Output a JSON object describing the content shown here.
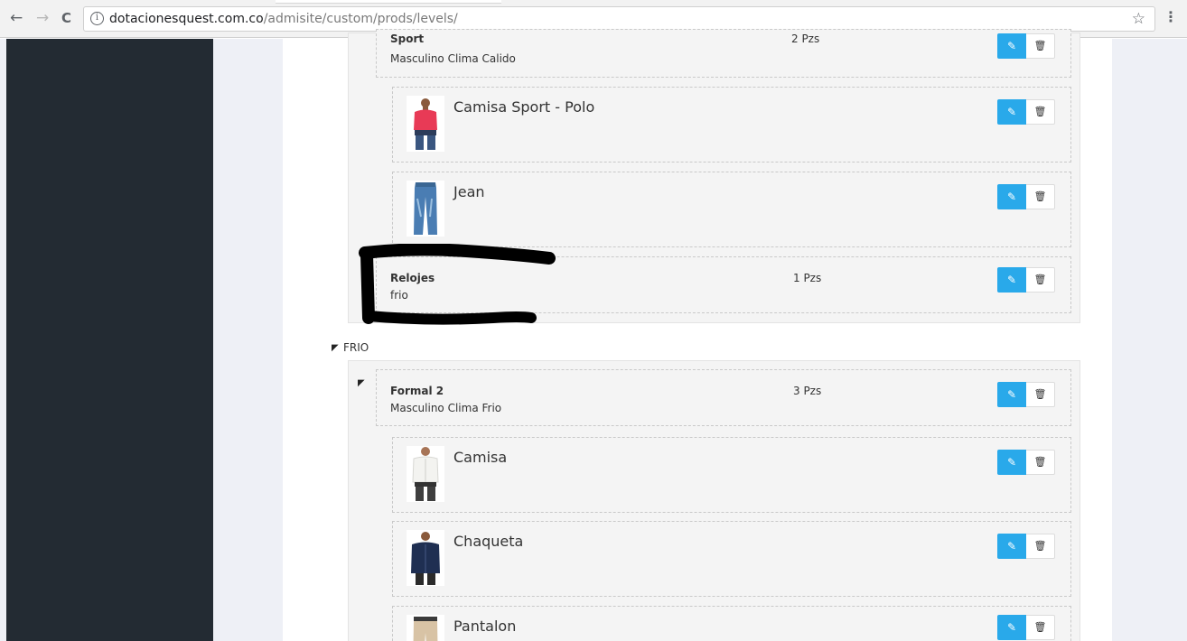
{
  "browser": {
    "back_icon": "←",
    "forward_icon": "→",
    "reload_icon": "C",
    "info_icon": "i",
    "url_host": "dotacionesquest.com.co",
    "url_path": "/admisite/custom/prods/levels/",
    "bookmark_icon": "☆",
    "menu_icon": "⋮"
  },
  "colors": {
    "sidebar": "#232b33",
    "accent": "#29a9ea",
    "page_bg": "#eef0f6"
  },
  "groups_top": [
    {
      "title": "Sport",
      "subtitle": "Masculino Clima Calido",
      "qty": "2 Pzs"
    },
    {
      "title": "Relojes",
      "subtitle": "frio",
      "qty": "1 Pzs"
    }
  ],
  "products_top": [
    {
      "name": "Camisa Sport - Polo",
      "image_icon": "polo-shirt-man-image"
    },
    {
      "name": "Jean",
      "image_icon": "jeans-image"
    }
  ],
  "level_frio": {
    "label": "FRIO",
    "group": {
      "title": "Formal 2",
      "subtitle": "Masculino Clima Frio",
      "qty": "3 Pzs"
    },
    "products": [
      {
        "name": "Camisa",
        "image_icon": "white-shirt-man-image"
      },
      {
        "name": "Chaqueta",
        "image_icon": "jacket-man-image"
      },
      {
        "name": "Pantalon",
        "image_icon": "pants-image"
      }
    ]
  },
  "actions": {
    "edit_icon": "✎",
    "delete_icon": "🗑"
  }
}
